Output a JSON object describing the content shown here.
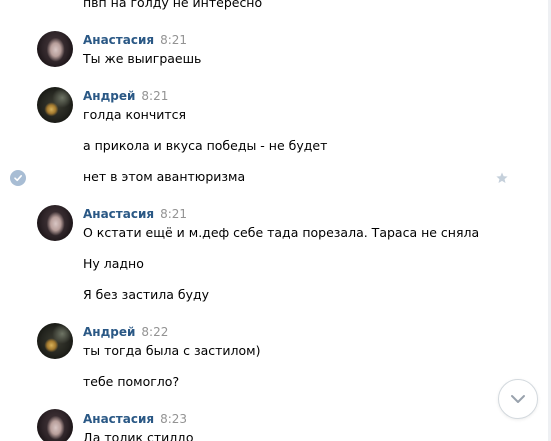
{
  "messages": {
    "top_partial": "пвп на голду не интересно",
    "group1": {
      "author": "Анастасия",
      "time": "8:21",
      "lines": [
        "Ты же выиграешь"
      ]
    },
    "group2": {
      "author": "Андрей",
      "time": "8:21",
      "lines": [
        "голда кончится",
        "а прикола и вкуса победы - не будет",
        "нет в этом авантюризма"
      ]
    },
    "group3": {
      "author": "Анастасия",
      "time": "8:21",
      "lines": [
        "О кстати ещё и м.деф себе тада порезала. Тараса не сняла",
        "Ну ладно",
        "Я без застила буду"
      ]
    },
    "group4": {
      "author": "Андрей",
      "time": "8:22",
      "lines": [
        "ты тогда была с застилом)",
        "тебе помогло?"
      ]
    },
    "group5": {
      "author": "Анастасия",
      "time": "8:23",
      "lines": [
        "Да толик стилдо"
      ]
    }
  },
  "icons": {
    "selected_check": "check-circle-icon",
    "favorite": "star-icon",
    "scroll_down": "chevron-down-icon"
  },
  "colors": {
    "author_name": "#2a5885",
    "time": "#939393",
    "check_bg": "#a8bdd4",
    "star": "#c5d0db",
    "scroll_chevron": "#99a2ad"
  }
}
